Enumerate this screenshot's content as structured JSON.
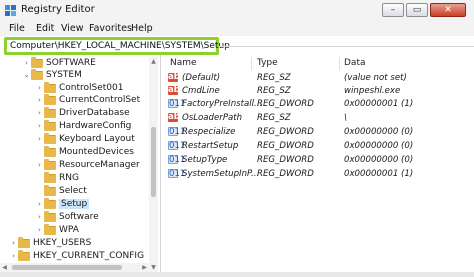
{
  "window": {
    "title": "Registry Editor"
  },
  "menu": [
    "File",
    "Edit",
    "View",
    "Favorites",
    "Help"
  ],
  "address": "Computer\\HKEY_LOCAL_MACHINE\\SYSTEM\\Setup",
  "tree": [
    {
      "label": "SOFTWARE",
      "arrow": "›"
    },
    {
      "label": "SYSTEM",
      "arrow": "⌄"
    },
    {
      "label": "ControlSet001",
      "arrow": "›"
    },
    {
      "label": "CurrentControlSet",
      "arrow": "›"
    },
    {
      "label": "DriverDatabase",
      "arrow": "›"
    },
    {
      "label": "HardwareConfig",
      "arrow": "›"
    },
    {
      "label": "Keyboard Layout",
      "arrow": "›"
    },
    {
      "label": "MountedDevices",
      "arrow": ""
    },
    {
      "label": "ResourceManager",
      "arrow": "›"
    },
    {
      "label": "RNG",
      "arrow": ""
    },
    {
      "label": "Select",
      "arrow": ""
    },
    {
      "label": "Setup",
      "arrow": "›"
    },
    {
      "label": "Software",
      "arrow": "›"
    },
    {
      "label": "WPA",
      "arrow": "›"
    },
    {
      "label": "HKEY_USERS",
      "arrow": "›"
    },
    {
      "label": "HKEY_CURRENT_CONFIG",
      "arrow": "›"
    }
  ],
  "columns": {
    "name": "Name",
    "type": "Type",
    "data": "Data"
  },
  "values": [
    {
      "icon": "ab",
      "name": "(Default)",
      "type": "REG_SZ",
      "data": "(value not set)"
    },
    {
      "icon": "ab",
      "name": "CmdLine",
      "type": "REG_SZ",
      "data": "winpeshl.exe"
    },
    {
      "icon": "011",
      "name": "FactoryPreInstall...",
      "type": "REG_DWORD",
      "data": "0x00000001 (1)"
    },
    {
      "icon": "ab",
      "name": "OsLoaderPath",
      "type": "REG_SZ",
      "data": "\\"
    },
    {
      "icon": "011",
      "name": "Respecialize",
      "type": "REG_DWORD",
      "data": "0x00000000 (0)"
    },
    {
      "icon": "011",
      "name": "RestartSetup",
      "type": "REG_DWORD",
      "data": "0x00000000 (0)"
    },
    {
      "icon": "011",
      "name": "SetupType",
      "type": "REG_DWORD",
      "data": "0x00000000 (0)"
    },
    {
      "icon": "011",
      "name": "SystemSetupInP...",
      "type": "REG_DWORD",
      "data": "0x00000001 (1)"
    }
  ],
  "colors": {
    "highlight": "#8cd22d",
    "selection": "#cce4f7",
    "folder": "#e9b84a"
  }
}
